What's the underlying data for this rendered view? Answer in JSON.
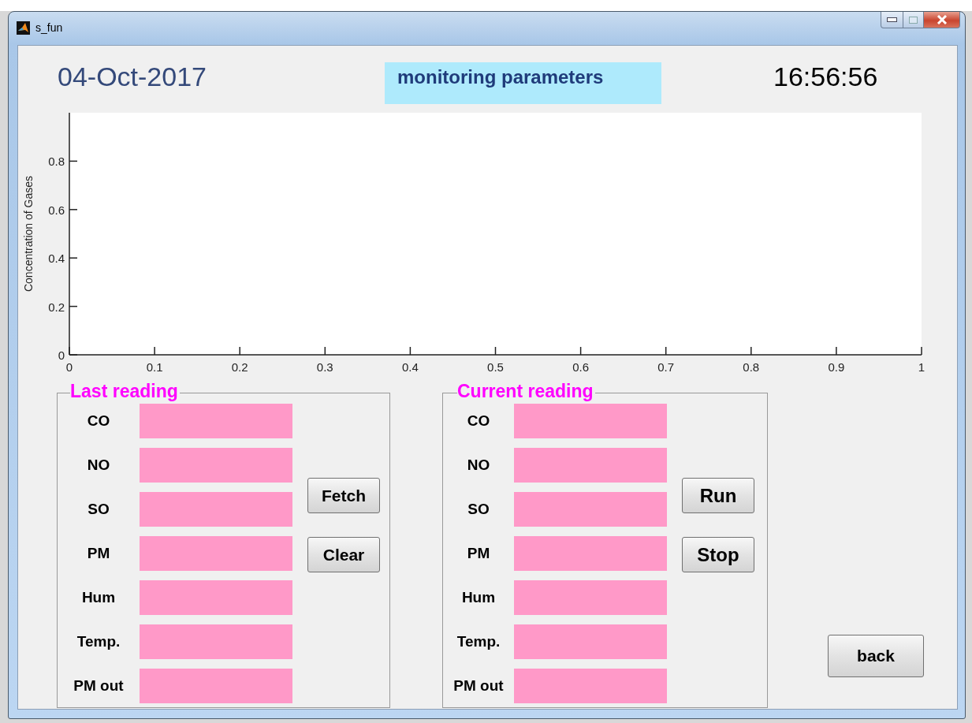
{
  "window": {
    "title": "s_fun"
  },
  "date": "04-Oct-2017",
  "heading": "monitoring parameters",
  "time": "16:56:56",
  "chart": {
    "chart_data": {
      "type": "line",
      "ylabel": "Concentration of Gases",
      "xlim": [
        0,
        1
      ],
      "ylim": [
        0,
        1
      ],
      "xticks": [
        0,
        0.1,
        0.2,
        0.3,
        0.4,
        0.5,
        0.6,
        0.7,
        0.8,
        0.9,
        1
      ],
      "yticks": [
        0,
        0.2,
        0.4,
        0.6,
        0.8
      ]
    }
  },
  "panels": [
    {
      "title": "Last reading",
      "fields": [
        {
          "label": "CO"
        },
        {
          "label": "NO"
        },
        {
          "label": "SO"
        },
        {
          "label": "PM"
        },
        {
          "label": "Hum"
        },
        {
          "label": "Temp."
        },
        {
          "label": "PM out"
        }
      ],
      "buttons": [
        "Fetch",
        "Clear"
      ]
    },
    {
      "title": "Current reading",
      "fields": [
        {
          "label": "CO"
        },
        {
          "label": "NO"
        },
        {
          "label": "SO"
        },
        {
          "label": "PM"
        },
        {
          "label": "Hum"
        },
        {
          "label": "Temp."
        },
        {
          "label": "PM out"
        }
      ],
      "buttons": [
        "Run",
        "Stop"
      ]
    }
  ],
  "back_button": "back"
}
